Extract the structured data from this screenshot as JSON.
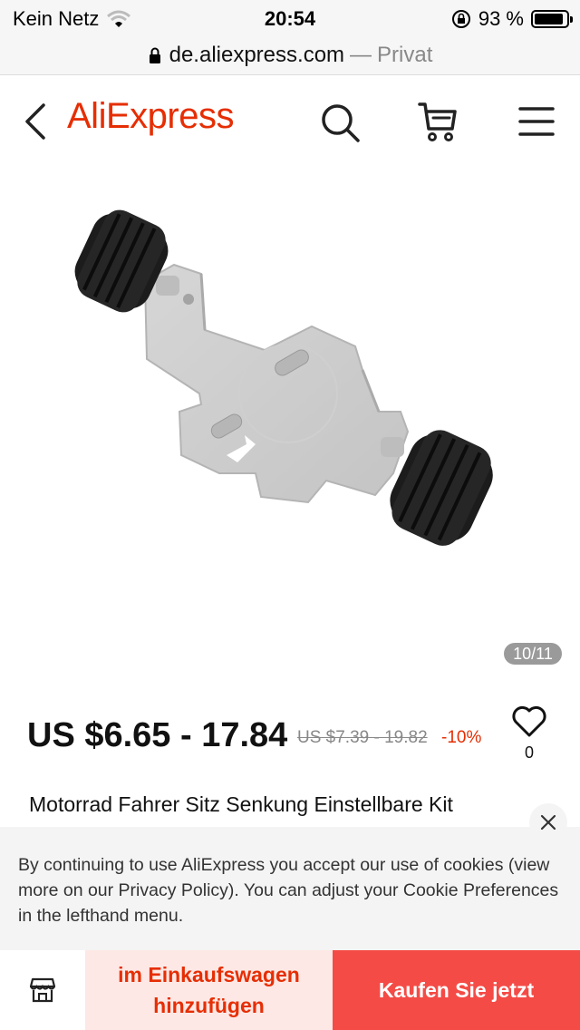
{
  "status_bar": {
    "carrier": "Kein Netz",
    "time": "20:54",
    "battery_percent": "93 %",
    "battery_level": 0.93
  },
  "url_bar": {
    "domain": "de.aliexpress.com",
    "separator": "—",
    "mode": "Privat"
  },
  "header": {
    "logo_text": "AliExpress",
    "brand_color": "#e62e04",
    "icons": [
      "chevron-left-icon",
      "search-icon",
      "cart-icon",
      "hamburger-menu-icon"
    ]
  },
  "product": {
    "image_icon": "product-image-mount-bracket",
    "image_counter": "10/11",
    "price": "US $6.65 - 17.84",
    "original_price": "US $7.39 - 19.82",
    "discount": "-10%",
    "wishlist_count": "0",
    "title": "Motorrad Fahrer Sitz Senkung Einstellbare Kit"
  },
  "cookie_banner": {
    "text": "By continuing to use AliExpress you accept our use of cookies (view more on our Privacy Policy). You can adjust your Cookie Preferences in the lefthand menu."
  },
  "bottom_bar": {
    "add_to_cart_label": "im Einkaufswagen hinzufügen",
    "buy_now_label": "Kaufen Sie jetzt",
    "buy_color": "#f44b46",
    "add_color": "#fde8e5"
  }
}
